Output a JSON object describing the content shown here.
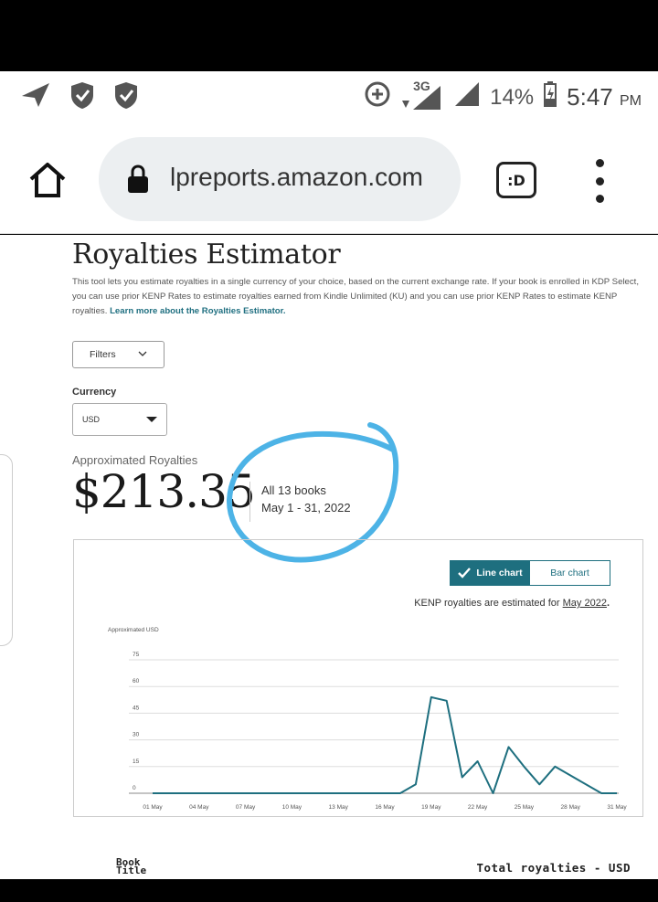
{
  "status_bar": {
    "network": "3G",
    "battery": "14%",
    "time": "5:47",
    "ampm": "PM"
  },
  "browser": {
    "url": "lpreports.amazon.com",
    "tabs_label": ":D"
  },
  "page": {
    "title": "Royalties Estimator",
    "description": "This tool lets you estimate royalties in a single currency of your choice, based on the current exchange rate. If your book is enrolled in KDP Select, you can use prior KENP Rates to estimate royalties earned from Kindle Unlimited (KU) and you can use prior KENP Rates to estimate KENP royalties.",
    "learn_more": "Learn more about the Royalties Estimator.",
    "filters_label": "Filters",
    "currency_label": "Currency",
    "currency_value": "USD",
    "approx_label": "Approximated Royalties",
    "amount": "$213.35",
    "books": "All 13 books",
    "date_range": "May 1 - 31, 2022",
    "line_chart_label": "Line chart",
    "bar_chart_label": "Bar chart",
    "kenp_note": "KENP royalties are estimated for",
    "kenp_month": "May 2022",
    "book_title_label": "Book Title",
    "total_label": "Total royalties - USD"
  },
  "chart_data": {
    "type": "line",
    "ylabel": "Approximated USD",
    "ylim": [
      0,
      75
    ],
    "yticks": [
      75,
      60,
      45,
      30,
      15,
      0
    ],
    "x_tick_labels": [
      "01 May",
      "04 May",
      "07 May",
      "10 May",
      "13 May",
      "16 May",
      "19 May",
      "22 May",
      "25 May",
      "28 May",
      "31 May"
    ],
    "x": [
      1,
      2,
      3,
      4,
      5,
      6,
      7,
      8,
      9,
      10,
      11,
      12,
      13,
      14,
      15,
      16,
      17,
      18,
      19,
      20,
      21,
      22,
      23,
      24,
      25,
      26,
      27,
      28,
      29,
      30,
      31
    ],
    "values": [
      0,
      0,
      0,
      0,
      0,
      0,
      0,
      0,
      0,
      0,
      0,
      0,
      0,
      0,
      0,
      0,
      0,
      5,
      54,
      52,
      9,
      18,
      0,
      26,
      15,
      5,
      15,
      10,
      5,
      0,
      0
    ],
    "color": "#1e6f7f",
    "grid": true
  }
}
